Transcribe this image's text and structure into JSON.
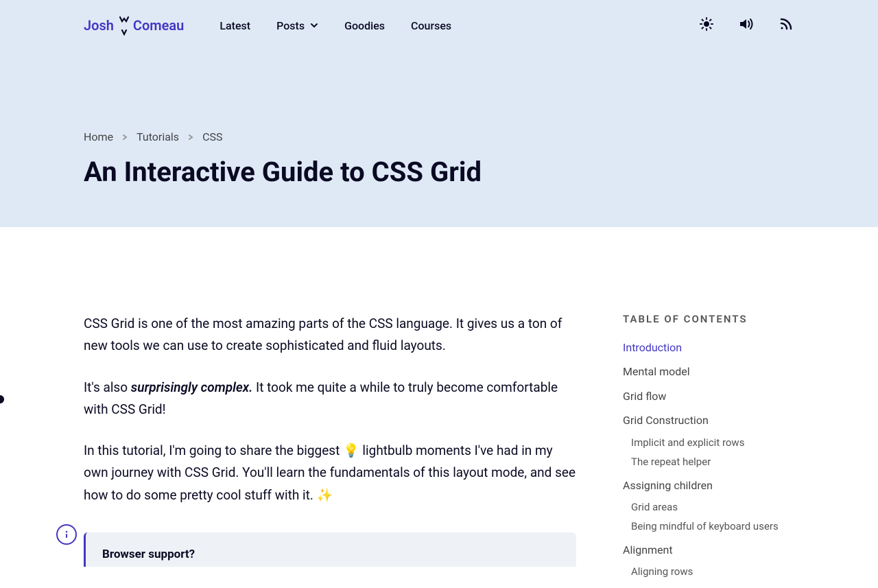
{
  "logo": {
    "first": "Josh",
    "last": "Comeau"
  },
  "nav": {
    "latest": "Latest",
    "posts": "Posts",
    "goodies": "Goodies",
    "courses": "Courses"
  },
  "breadcrumb": {
    "home": "Home",
    "tutorials": "Tutorials",
    "css": "CSS"
  },
  "title": "An Interactive Guide to CSS Grid",
  "article": {
    "p1": "CSS Grid is one of the most amazing parts of the CSS language. It gives us a ton of new tools we can use to create sophisticated and fluid layouts.",
    "p2_start": "It's also ",
    "p2_em": "surprisingly complex.",
    "p2_end": " It took me quite a while to truly become comfortable with CSS Grid!",
    "p3": "In this tutorial, I'm going to share the biggest 💡 lightbulb moments I've had in my own journey with CSS Grid. You'll learn the fundamentals of this layout mode, and see how to do some pretty cool stuff with it. ✨"
  },
  "callout": {
    "title": "Browser support?"
  },
  "toc": {
    "heading": "TABLE OF CONTENTS",
    "items": [
      {
        "label": "Introduction",
        "active": true
      },
      {
        "label": "Mental model",
        "active": false
      },
      {
        "label": "Grid flow",
        "active": false
      },
      {
        "label": "Grid Construction",
        "active": false,
        "children": [
          {
            "label": "Implicit and explicit rows"
          },
          {
            "label": "The repeat helper"
          }
        ]
      },
      {
        "label": "Assigning children",
        "active": false,
        "children": [
          {
            "label": "Grid areas"
          },
          {
            "label": "Being mindful of keyboard users"
          }
        ]
      },
      {
        "label": "Alignment",
        "active": false,
        "children": [
          {
            "label": "Aligning rows"
          }
        ]
      }
    ]
  }
}
